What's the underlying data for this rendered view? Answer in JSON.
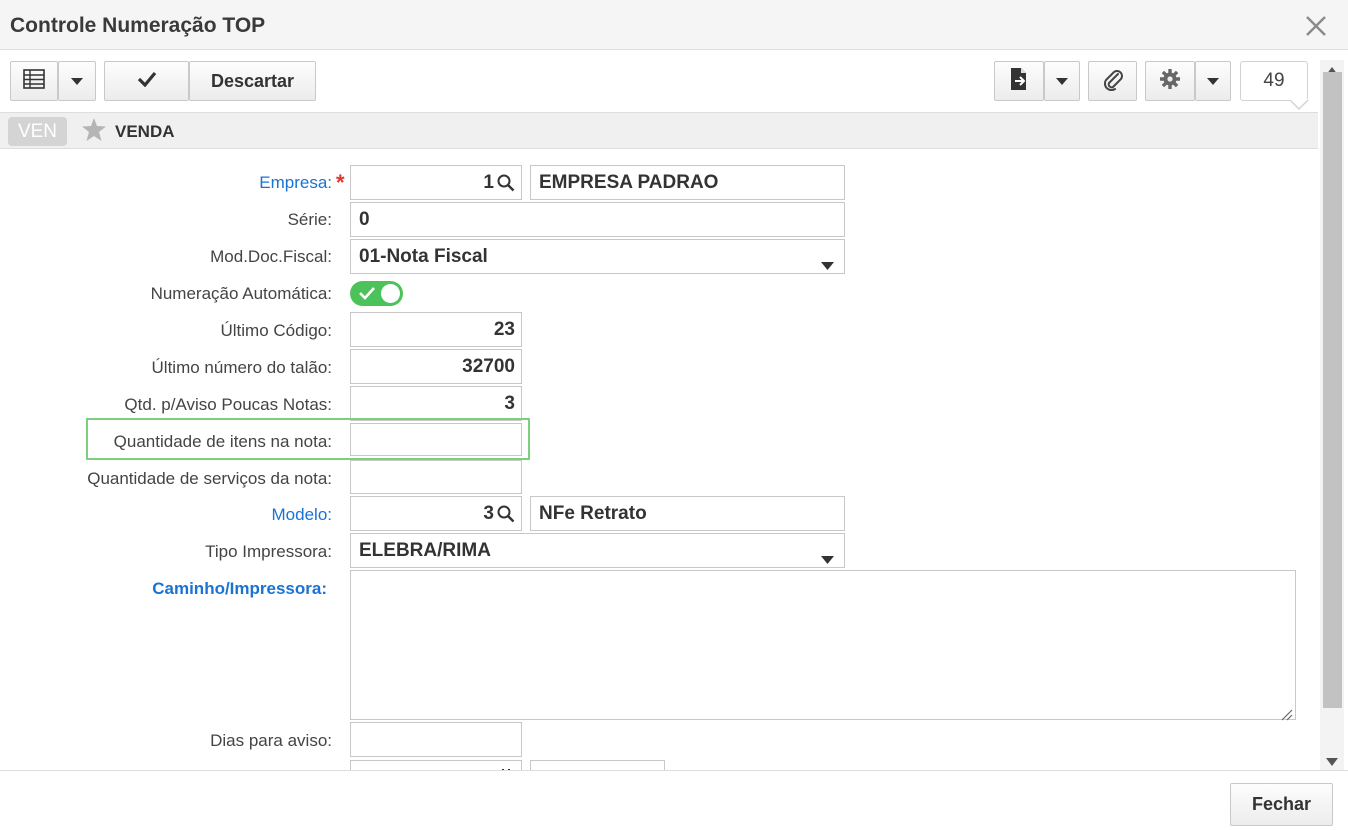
{
  "window": {
    "title": "Controle Numeração TOP"
  },
  "toolbar": {
    "grid_icon": "grid-icon",
    "confirm_icon": "check-icon",
    "discard_label": "Descartar",
    "record_count": "49"
  },
  "section": {
    "code": "VEN",
    "name": "VENDA"
  },
  "form": {
    "empresa": {
      "label": "Empresa:",
      "code": "1",
      "name": "EMPRESA PADRAO"
    },
    "serie": {
      "label": "Série:",
      "value": "0"
    },
    "mod_doc_fiscal": {
      "label": "Mod.Doc.Fiscal:",
      "value": "01-Nota Fiscal"
    },
    "numeracao_automatica": {
      "label": "Numeração Automática:",
      "checked": true
    },
    "ultimo_codigo": {
      "label": "Último Código:",
      "value": "23"
    },
    "ultimo_numero_talao": {
      "label": "Último número do talão:",
      "value": "32700"
    },
    "qtd_aviso": {
      "label": "Qtd. p/Aviso Poucas Notas:",
      "value": "3"
    },
    "qtd_itens": {
      "label": "Quantidade de itens na nota:",
      "value": ""
    },
    "qtd_servicos": {
      "label": "Quantidade de serviços da nota:",
      "value": ""
    },
    "modelo": {
      "label": "Modelo:",
      "code": "3",
      "name": "NFe Retrato"
    },
    "tipo_impressora": {
      "label": "Tipo Impressora:",
      "value": "ELEBRA/RIMA"
    },
    "caminho_impressora": {
      "label": "Caminho/Impressora:",
      "value": ""
    },
    "dias_aviso": {
      "label": "Dias para aviso:",
      "value": ""
    }
  },
  "footer": {
    "close_label": "Fechar"
  },
  "colors": {
    "accent": "#1a73d4",
    "toggle_on": "#4cc25a",
    "required": "#e0342a",
    "highlight": "#7bd07e"
  }
}
